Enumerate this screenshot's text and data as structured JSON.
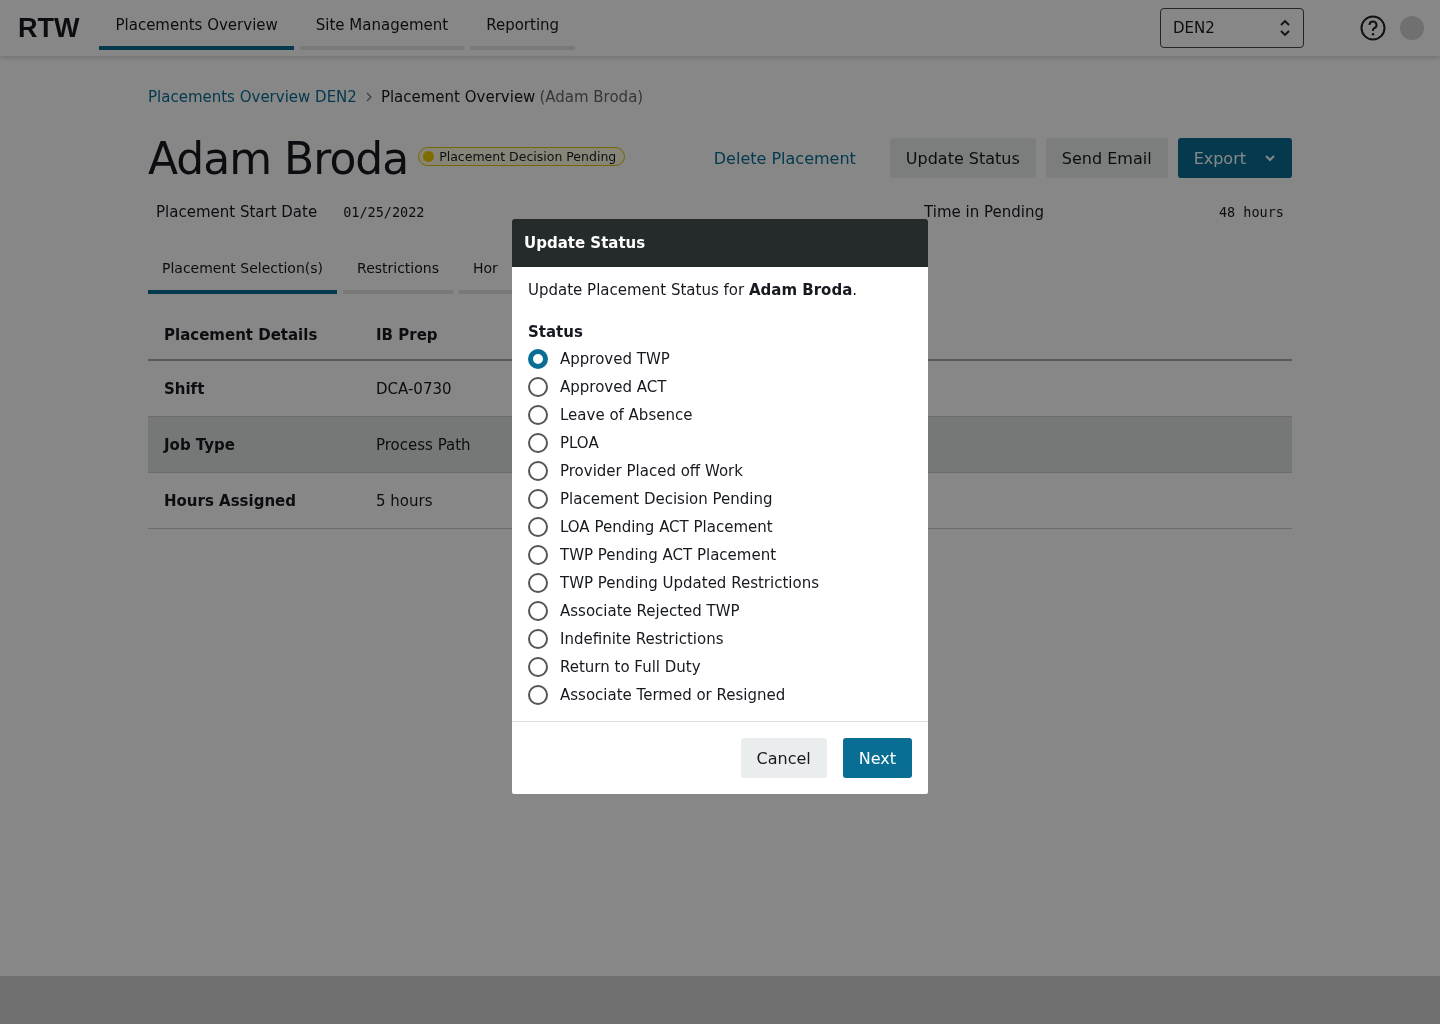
{
  "app": {
    "logo": "RTW"
  },
  "nav_tabs": [
    {
      "label": "Placements Overview",
      "selected": true
    },
    {
      "label": "Site Management",
      "selected": false
    },
    {
      "label": "Reporting",
      "selected": false
    }
  ],
  "site_select": {
    "value": "DEN2"
  },
  "breadcrumb": {
    "link": "Placements Overview DEN2",
    "current": "Placement Overview",
    "current_note": "(Adam Broda)"
  },
  "person": {
    "name": "Adam Broda",
    "status_badge": "Placement Decision Pending"
  },
  "actions": [
    {
      "label": "Delete Placement",
      "kind": "link"
    },
    {
      "label": "Update Status",
      "kind": "secondary"
    },
    {
      "label": "Send Email",
      "kind": "secondary"
    },
    {
      "label": "Export",
      "kind": "dropdown"
    }
  ],
  "info": [
    {
      "label": "Placement Start Date",
      "value": "01/25/2022"
    },
    {
      "label": "Time in Pending",
      "value": "48 hours"
    }
  ],
  "content_tabs": [
    {
      "label": "Placement Selection(s)",
      "selected": true
    },
    {
      "label": "Restrictions",
      "selected": false
    },
    {
      "label": "Hor",
      "selected": false
    }
  ],
  "table": {
    "columns": [
      "Placement Details",
      "IB Prep"
    ],
    "rows": [
      {
        "cells": [
          "Shift",
          "DCA-0730"
        ],
        "hovered": false
      },
      {
        "cells": [
          "Job Type",
          "Process Path"
        ],
        "hovered": true
      },
      {
        "cells": [
          "Hours Assigned",
          "5 hours"
        ],
        "hovered": false
      }
    ]
  },
  "modal": {
    "title": "Update Status",
    "intro": "Update Placement Status for **Adam Broda**.",
    "group_label": "Status",
    "options": [
      {
        "label": "Approved TWP",
        "selected": true
      },
      {
        "label": "Approved ACT",
        "selected": false
      },
      {
        "label": "Leave of Absence",
        "selected": false
      },
      {
        "label": "PLOA",
        "selected": false
      },
      {
        "label": "Provider Placed off Work",
        "selected": false
      },
      {
        "label": "Placement Decision Pending",
        "selected": false
      },
      {
        "label": "LOA Pending ACT Placement",
        "selected": false
      },
      {
        "label": "TWP Pending ACT Placement",
        "selected": false
      },
      {
        "label": "TWP Pending Updated Restrictions",
        "selected": false
      },
      {
        "label": "Associate Rejected TWP",
        "selected": false
      },
      {
        "label": "Indefinite Restrictions",
        "selected": false
      },
      {
        "label": "Return to Full Duty",
        "selected": false
      },
      {
        "label": "Associate Termed or Resigned",
        "selected": false
      }
    ],
    "buttons": [
      {
        "label": "Cancel",
        "kind": "secondary"
      },
      {
        "label": "Next",
        "kind": "primary"
      }
    ]
  }
}
